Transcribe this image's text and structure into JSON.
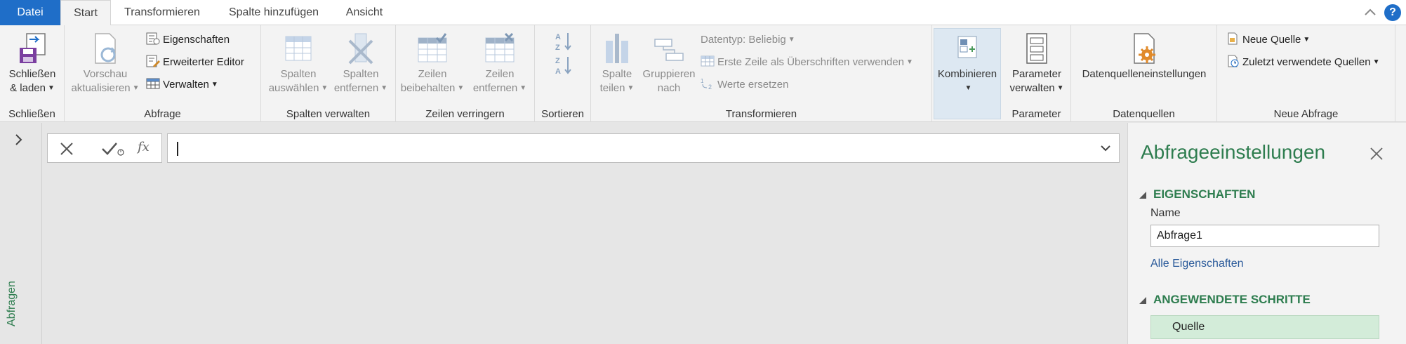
{
  "tabs": {
    "file": "Datei",
    "start": "Start",
    "transform": "Transformieren",
    "add_column": "Spalte hinzufügen",
    "view": "Ansicht",
    "help": "?"
  },
  "ribbon": {
    "close_load": {
      "line1": "Schließen",
      "line2": "& laden",
      "group": "Schließen"
    },
    "query": {
      "preview_line1": "Vorschau",
      "preview_line2": "aktualisieren",
      "properties": "Eigenschaften",
      "advanced_editor": "Erweiterter Editor",
      "manage": "Verwalten",
      "group": "Abfrage"
    },
    "columns": {
      "choose_line1": "Spalten",
      "choose_line2": "auswählen",
      "remove_line1": "Spalten",
      "remove_line2": "entfernen",
      "group": "Spalten verwalten"
    },
    "rows": {
      "keep_line1": "Zeilen",
      "keep_line2": "beibehalten",
      "remove_line1": "Zeilen",
      "remove_line2": "entfernen",
      "group": "Zeilen verringern"
    },
    "sort": {
      "group": "Sortieren"
    },
    "transform": {
      "split_line1": "Spalte",
      "split_line2": "teilen",
      "group_by_line1": "Gruppieren",
      "group_by_line2": "nach",
      "datatype": "Datentyp: Beliebig",
      "first_row_header": "Erste Zeile als Überschriften verwenden",
      "replace_values": "Werte ersetzen",
      "group": "Transformieren"
    },
    "combine": {
      "label": "Kombinieren"
    },
    "parameters": {
      "line1": "Parameter",
      "line2": "verwalten",
      "group": "Parameter"
    },
    "datasources": {
      "label": "Datenquelleneinstellungen",
      "group": "Datenquellen"
    },
    "new_query": {
      "new_source": "Neue Quelle",
      "recent_sources": "Zuletzt verwendete Quellen",
      "group": "Neue Abfrage"
    }
  },
  "left_panel": {
    "label": "Abfragen"
  },
  "formula_bar": {
    "fx": "fx",
    "value": ""
  },
  "settings": {
    "title": "Abfrageeinstellungen",
    "properties_header": "EIGENSCHAFTEN",
    "name_label": "Name",
    "name_value": "Abfrage1",
    "all_properties": "Alle Eigenschaften",
    "applied_steps_header": "ANGEWENDETE SCHRITTE",
    "steps": [
      "Quelle"
    ]
  },
  "colors": {
    "accent_blue": "#1f6ec8",
    "green": "#2e7d4f",
    "step_selected": "#d3ecd9",
    "kombinieren_bg": "#dde8f2"
  }
}
